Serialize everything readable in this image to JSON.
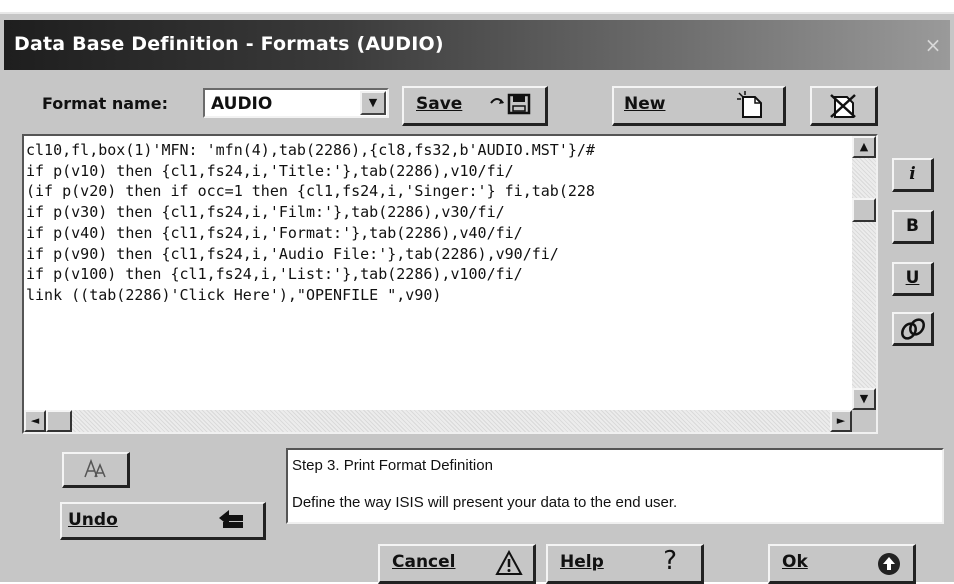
{
  "window": {
    "title": "Data Base Definition - Formats (AUDIO)",
    "close_glyph": "×"
  },
  "format": {
    "label": "Format name:",
    "value": "AUDIO"
  },
  "toolbar": {
    "save_label": "Save",
    "new_label": "New"
  },
  "editor": {
    "lines": [
      "cl10,fl,box(1)'MFN: 'mfn(4),tab(2286),{cl8,fs32,b'AUDIO.MST'}/#",
      "if p(v10) then {cl1,fs24,i,'Title:'},tab(2286),v10/fi/",
      "(if p(v20) then if occ=1 then {cl1,fs24,i,'Singer:'} fi,tab(228",
      "if p(v30) then {cl1,fs24,i,'Film:'},tab(2286),v30/fi/",
      "if p(v40) then {cl1,fs24,i,'Format:'},tab(2286),v40/fi/",
      "if p(v90) then {cl1,fs24,i,'Audio File:'},tab(2286),v90/fi/",
      "if p(v100) then {cl1,fs24,i,'List:'},tab(2286),v100/fi/",
      "link ((tab(2286)'Click Here'),\"OPENFILE \",v90)"
    ]
  },
  "side_buttons": {
    "italic": "i",
    "bold": "B",
    "underline": "U"
  },
  "help": {
    "line1": "Step 3. Print Format Definition",
    "line2": "Define the way ISIS will present your data to the end user."
  },
  "buttons": {
    "undo_label": "Undo",
    "cancel_label": "Cancel",
    "help_label": "Help",
    "ok_label": "Ok"
  },
  "icons": {
    "save": "save-icon",
    "new": "new-document-icon",
    "delete": "delete-icon",
    "font": "font-icon",
    "link": "link-icon",
    "undo": "undo-icon",
    "cancel": "warning-icon",
    "help": "question-icon",
    "ok": "ok-icon"
  }
}
